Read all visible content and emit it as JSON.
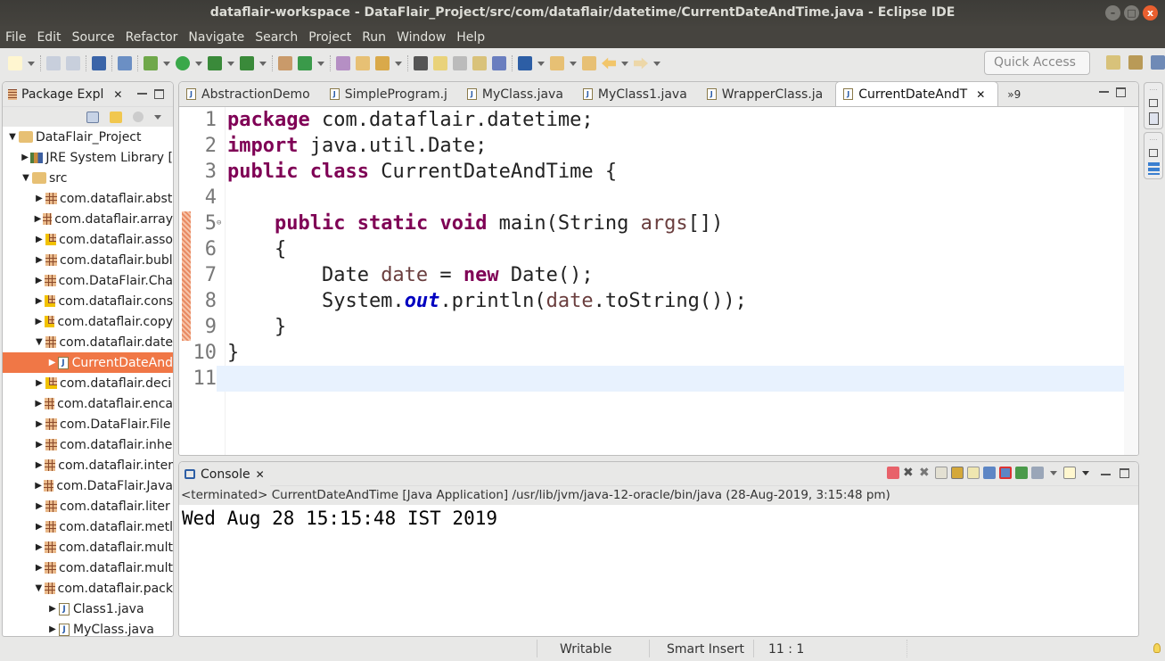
{
  "window": {
    "title": "dataflair-workspace - DataFlair_Project/src/com/dataflair/datetime/CurrentDateAndTime.java - Eclipse IDE",
    "controls": {
      "minimize": "–",
      "maximize": "□",
      "close": "x"
    }
  },
  "menu": [
    "File",
    "Edit",
    "Source",
    "Refactor",
    "Navigate",
    "Search",
    "Project",
    "Run",
    "Window",
    "Help"
  ],
  "toolbar": {
    "icons": [
      "new-icon",
      "save-icon",
      "save-all-icon",
      "terminal-icon",
      "skip-breakpoints-icon",
      "debug-icon",
      "run-icon",
      "coverage-icon",
      "external-tools-icon",
      "new-java-package-icon",
      "new-java-class-icon",
      "open-type-icon",
      "open-task-icon",
      "search-icon",
      "toggle-mark-occurrences-icon",
      "toggle-highlight-icon",
      "toggle-block-selection-icon",
      "word-wrap-icon",
      "show-whitespace-icon",
      "next-annotation-icon",
      "previous-annotation-icon",
      "last-edit-location-icon",
      "back-icon",
      "forward-icon"
    ],
    "quick_access_placeholder": "Quick Access"
  },
  "package_explorer": {
    "title": "Package Expl",
    "tree": [
      {
        "label": "DataFlair_Project",
        "level": 0,
        "expanded": true,
        "type": "project"
      },
      {
        "label": "JRE System Library [",
        "level": 1,
        "expanded": false,
        "type": "library"
      },
      {
        "label": "src",
        "level": 1,
        "expanded": true,
        "type": "source-folder"
      },
      {
        "label": "com.dataflair.abst",
        "level": 2,
        "expanded": false,
        "type": "package"
      },
      {
        "label": "com.dataflair.array",
        "level": 2,
        "expanded": false,
        "type": "package"
      },
      {
        "label": "com.dataflair.asso",
        "level": 2,
        "expanded": false,
        "type": "package",
        "warning": true
      },
      {
        "label": "com.dataflair.bubl",
        "level": 2,
        "expanded": false,
        "type": "package"
      },
      {
        "label": "com.DataFlair.Cha",
        "level": 2,
        "expanded": false,
        "type": "package"
      },
      {
        "label": "com.dataflair.cons",
        "level": 2,
        "expanded": false,
        "type": "package",
        "warning": true
      },
      {
        "label": "com.dataflair.copy",
        "level": 2,
        "expanded": false,
        "type": "package",
        "warning": true
      },
      {
        "label": "com.dataflair.date",
        "level": 2,
        "expanded": true,
        "type": "package"
      },
      {
        "label": "CurrentDateAnd",
        "level": 3,
        "expanded": false,
        "type": "java-file",
        "selected": true
      },
      {
        "label": "com.dataflair.deci",
        "level": 2,
        "expanded": false,
        "type": "package",
        "warning": true
      },
      {
        "label": "com.dataflair.enca",
        "level": 2,
        "expanded": false,
        "type": "package"
      },
      {
        "label": "com.DataFlair.File",
        "level": 2,
        "expanded": false,
        "type": "package"
      },
      {
        "label": "com.dataflair.inhe",
        "level": 2,
        "expanded": false,
        "type": "package"
      },
      {
        "label": "com.dataflair.inter",
        "level": 2,
        "expanded": false,
        "type": "package"
      },
      {
        "label": "com.DataFlair.Java",
        "level": 2,
        "expanded": false,
        "type": "package"
      },
      {
        "label": "com.dataflair.liter",
        "level": 2,
        "expanded": false,
        "type": "package"
      },
      {
        "label": "com.dataflair.metl",
        "level": 2,
        "expanded": false,
        "type": "package"
      },
      {
        "label": "com.dataflair.mult",
        "level": 2,
        "expanded": false,
        "type": "package"
      },
      {
        "label": "com.dataflair.mult",
        "level": 2,
        "expanded": false,
        "type": "package"
      },
      {
        "label": "com.dataflair.pack",
        "level": 2,
        "expanded": true,
        "type": "package"
      },
      {
        "label": "Class1.java",
        "level": 3,
        "expanded": false,
        "type": "java-file"
      },
      {
        "label": "MyClass.java",
        "level": 3,
        "expanded": false,
        "type": "java-file"
      }
    ]
  },
  "editor": {
    "tabs": [
      {
        "label": "AbstractionDemo",
        "active": false
      },
      {
        "label": "SimpleProgram.j",
        "active": false
      },
      {
        "label": "MyClass.java",
        "active": false
      },
      {
        "label": "MyClass1.java",
        "active": false
      },
      {
        "label": "WrapperClass.ja",
        "active": false
      },
      {
        "label": "CurrentDateAndT",
        "active": true
      }
    ],
    "overflow_label": "»9",
    "current_line": 11,
    "lines": [
      {
        "n": "1",
        "tokens": [
          [
            "kw",
            "package"
          ],
          [
            "",
            " com.dataflair.datetime;"
          ]
        ]
      },
      {
        "n": "2",
        "tokens": [
          [
            "kw",
            "import"
          ],
          [
            "",
            " java.util.Date;"
          ]
        ]
      },
      {
        "n": "3",
        "tokens": [
          [
            "kw",
            "public"
          ],
          [
            "",
            " "
          ],
          [
            "kw",
            "class"
          ],
          [
            "",
            " CurrentDateAndTime {"
          ]
        ]
      },
      {
        "n": "4",
        "tokens": []
      },
      {
        "n": "5",
        "tokens": [
          [
            "",
            "    "
          ],
          [
            "kw",
            "public"
          ],
          [
            "",
            " "
          ],
          [
            "kw",
            "static"
          ],
          [
            "",
            " "
          ],
          [
            "kw",
            "void"
          ],
          [
            "",
            " main(String "
          ],
          [
            "var",
            "args"
          ],
          [
            "",
            "[])"
          ]
        ]
      },
      {
        "n": "6",
        "tokens": [
          [
            "",
            "    {"
          ]
        ]
      },
      {
        "n": "7",
        "tokens": [
          [
            "",
            "        Date "
          ],
          [
            "var",
            "date"
          ],
          [
            "",
            " = "
          ],
          [
            "kw",
            "new"
          ],
          [
            "",
            " Date();"
          ]
        ]
      },
      {
        "n": "8",
        "tokens": [
          [
            "",
            "        System."
          ],
          [
            "fld",
            "out"
          ],
          [
            "",
            ".println("
          ],
          [
            "var",
            "date"
          ],
          [
            "",
            ".toString());"
          ]
        ]
      },
      {
        "n": "9",
        "tokens": [
          [
            "",
            "    }"
          ]
        ]
      },
      {
        "n": "10",
        "tokens": [
          [
            "",
            "}"
          ]
        ]
      },
      {
        "n": "11",
        "tokens": []
      }
    ]
  },
  "console": {
    "title": "Console",
    "status": "<terminated> CurrentDateAndTime [Java Application] /usr/lib/jvm/java-12-oracle/bin/java (28-Aug-2019, 3:15:48 pm)",
    "output": "Wed Aug 28 15:15:48 IST 2019"
  },
  "statusbar": {
    "mode": "Writable",
    "insert": "Smart Insert",
    "position": "11 : 1"
  },
  "colors": {
    "selection": "#f07746",
    "keyword": "#7f0055",
    "variable": "#6a3e3e",
    "static_field": "#0000c0",
    "current_line": "#e8f2fe",
    "title_bar": "#3d3c38"
  }
}
